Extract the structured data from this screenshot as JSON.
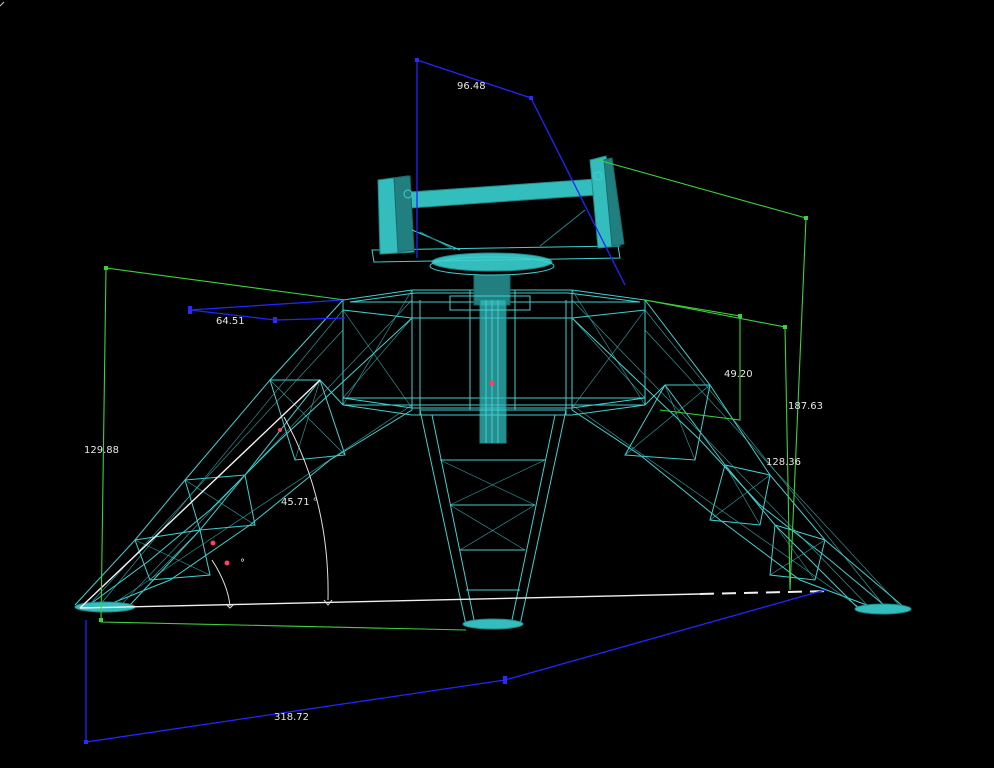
{
  "dimensions": {
    "top_width": "96.48",
    "left_arm": "64.51",
    "left_height": "129.88",
    "right_small": "49.20",
    "right_total": "187.63",
    "right_leg": "128.36",
    "base_length": "318.72"
  },
  "angles": {
    "outer_angle": "45.71 °",
    "inner_angle": "°"
  },
  "colors": {
    "background": "#000000",
    "wireframe": "#40d0d0",
    "dimension_blue": "#2424ff",
    "dimension_green": "#3cd23c",
    "label_text": "#e6e6e6"
  }
}
